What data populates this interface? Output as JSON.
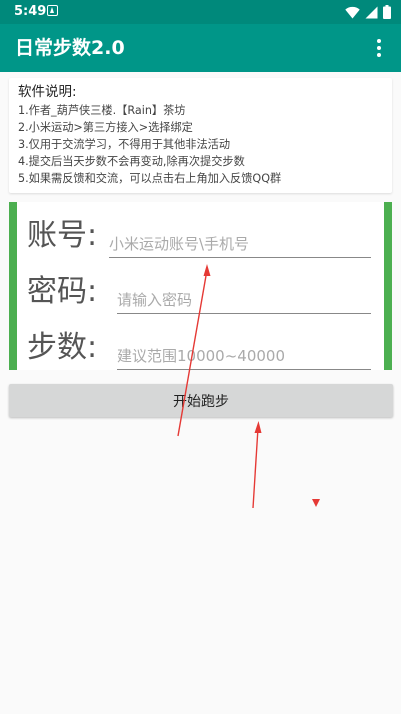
{
  "status_bar": {
    "time": "5:49"
  },
  "app_bar": {
    "title": "日常步数2.0"
  },
  "info": {
    "title": "软件说明:",
    "lines": [
      "1.作者_葫芦侠三楼.【Rain】茶坊",
      "2.小米运动>第三方接入>选择绑定",
      "3.仅用于交流学习，不得用于其他非法活动",
      "4.提交后当天步数不会再变动,除再次提交步数",
      "5.如果需反馈和交流，可以点击右上角加入反馈QQ群"
    ]
  },
  "form": {
    "account": {
      "label": "账号:",
      "placeholder": "小米运动账号\\手机号",
      "value": ""
    },
    "password": {
      "label": "密码:",
      "placeholder": "请输入密码",
      "value": ""
    },
    "steps": {
      "label": "步数:",
      "placeholder": "建议范围10000~40000",
      "value": ""
    }
  },
  "run_button": {
    "label": "开始跑步"
  },
  "colors": {
    "status_bar": "#00897b",
    "app_bar": "#009688",
    "form_accent": "#4caf50",
    "annotation_arrow": "#e53935"
  }
}
